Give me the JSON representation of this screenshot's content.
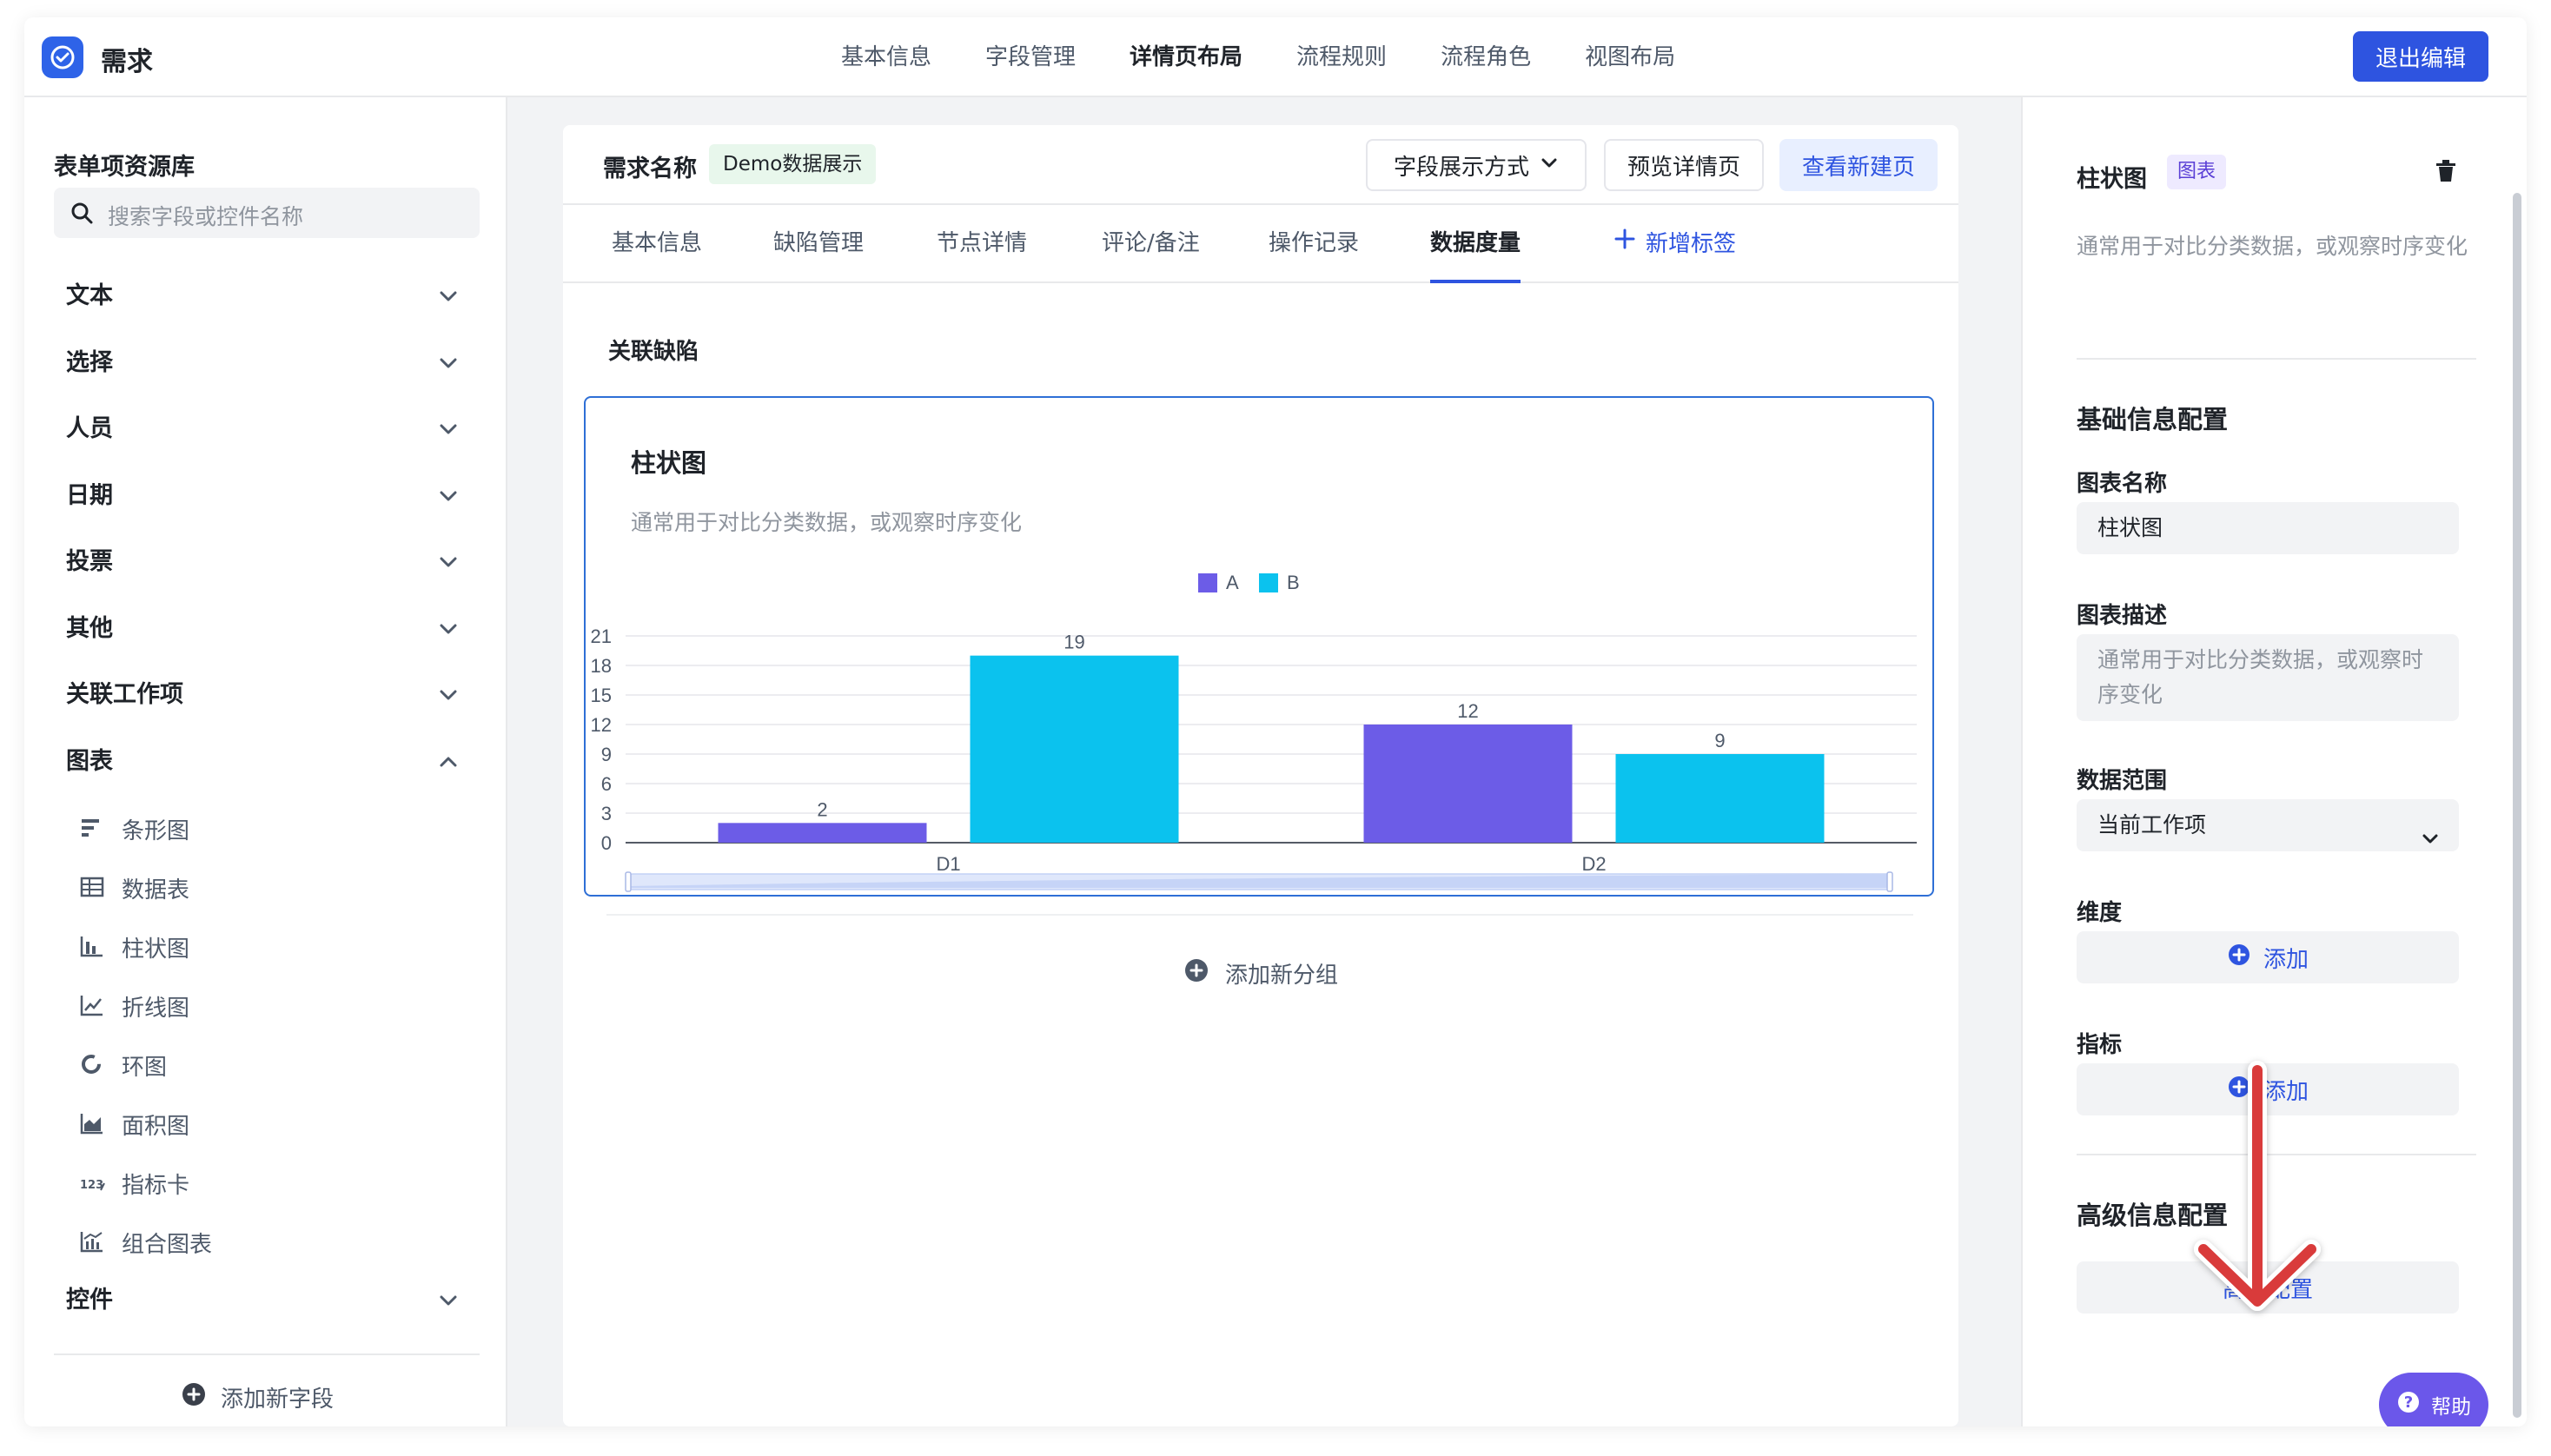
{
  "app": {
    "title": "需求",
    "exit_label": "退出编辑"
  },
  "top_nav": [
    {
      "label": "基本信息",
      "active": false
    },
    {
      "label": "字段管理",
      "active": false
    },
    {
      "label": "详情页布局",
      "active": true
    },
    {
      "label": "流程规则",
      "active": false
    },
    {
      "label": "流程角色",
      "active": false
    },
    {
      "label": "视图布局",
      "active": false
    }
  ],
  "sidebar": {
    "title": "表单项资源库",
    "search_placeholder": "搜索字段或控件名称",
    "categories": [
      {
        "label": "文本",
        "expanded": false
      },
      {
        "label": "选择",
        "expanded": false
      },
      {
        "label": "人员",
        "expanded": false
      },
      {
        "label": "日期",
        "expanded": false
      },
      {
        "label": "投票",
        "expanded": false
      },
      {
        "label": "其他",
        "expanded": false
      },
      {
        "label": "关联工作项",
        "expanded": false
      },
      {
        "label": "图表",
        "expanded": true
      },
      {
        "label": "控件",
        "expanded": false
      }
    ],
    "chart_items": [
      {
        "label": "条形图",
        "icon": "horizontal-bar-chart-icon"
      },
      {
        "label": "数据表",
        "icon": "table-icon"
      },
      {
        "label": "柱状图",
        "icon": "column-chart-icon"
      },
      {
        "label": "折线图",
        "icon": "line-chart-icon"
      },
      {
        "label": "环图",
        "icon": "donut-chart-icon"
      },
      {
        "label": "面积图",
        "icon": "area-chart-icon"
      },
      {
        "label": "指标卡",
        "icon": "metric-card-icon"
      },
      {
        "label": "组合图表",
        "icon": "combo-chart-icon"
      }
    ],
    "add_field_label": "添加新字段"
  },
  "detail": {
    "req_name_label": "需求名称",
    "demo_tag": "Demo数据展示",
    "field_display_label": "字段展示方式",
    "preview_label": "预览详情页",
    "view_new_label": "查看新建页",
    "tabs": [
      {
        "label": "基本信息",
        "active": false
      },
      {
        "label": "缺陷管理",
        "active": false
      },
      {
        "label": "节点详情",
        "active": false
      },
      {
        "label": "评论/备注",
        "active": false
      },
      {
        "label": "操作记录",
        "active": false
      },
      {
        "label": "数据度量",
        "active": true
      }
    ],
    "add_tab_label": "新增标签",
    "section_title": "关联缺陷",
    "chart_card_title": "柱状图",
    "chart_card_desc": "通常用于对比分类数据，或观察时序变化",
    "add_group_label": "添加新分组"
  },
  "chart_data": {
    "type": "bar",
    "categories": [
      "D1",
      "D2"
    ],
    "series": [
      {
        "name": "A",
        "values": [
          2,
          12
        ],
        "color": "#6c5ce7"
      },
      {
        "name": "B",
        "values": [
          19,
          9
        ],
        "color": "#0bc2ee"
      }
    ],
    "yticks": [
      "0",
      "3",
      "6",
      "9",
      "12",
      "15",
      "18",
      "21"
    ],
    "ylim": [
      0,
      21
    ],
    "legend_position": "top-center",
    "data_labels": true,
    "grid": true,
    "title": "",
    "xlabel": "",
    "ylabel": ""
  },
  "right_panel": {
    "title": "柱状图",
    "badge": "图表",
    "desc": "通常用于对比分类数据，或观察时序变化",
    "basic_config_heading": "基础信息配置",
    "chart_name_label": "图表名称",
    "chart_name_value": "柱状图",
    "chart_desc_label": "图表描述",
    "chart_desc_value": "通常用于对比分类数据，或观察时序变化",
    "data_range_label": "数据范围",
    "data_range_value": "当前工作项",
    "dimension_label": "维度",
    "dimension_add": "添加",
    "metric_label": "指标",
    "metric_add": "添加",
    "advanced_heading": "高级信息配置",
    "advanced_button": "高级配置"
  },
  "help_label": "帮助",
  "colors": {
    "accent": "#2e54e0",
    "series_a": "#6c5ce7",
    "series_b": "#0bc2ee",
    "arrow": "#d93b3b"
  }
}
